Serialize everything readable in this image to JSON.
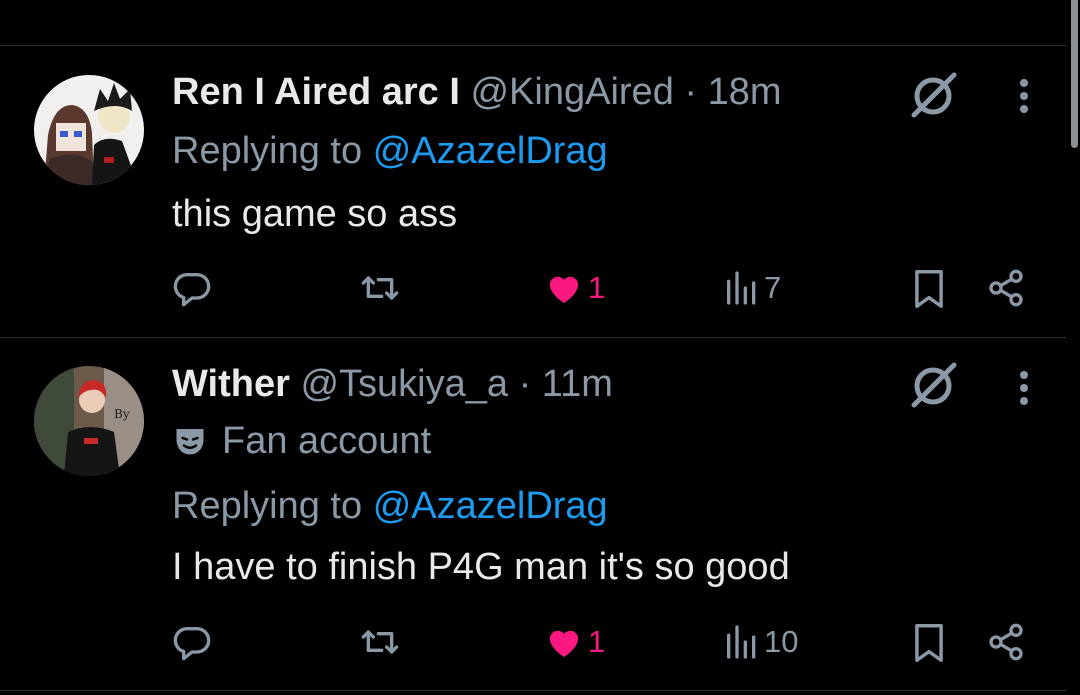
{
  "tweets": [
    {
      "name": "Ren I Aired arc I",
      "handle": "@KingAired",
      "separator": "·",
      "time": "18m",
      "replying_prefix": "Replying to",
      "replying_to": "@AzazelDrag",
      "text": "this game so ass",
      "likes": "1",
      "views": "7",
      "liked": true
    },
    {
      "name": "Wither",
      "handle": "@Tsukiya_a",
      "separator": "·",
      "time": "11m",
      "badge": "Fan account",
      "replying_prefix": "Replying to",
      "replying_to": "@AzazelDrag",
      "text": "I have to finish P4G man it's so good",
      "likes": "1",
      "views": "10",
      "liked": true
    }
  ],
  "colors": {
    "background": "#000000",
    "text": "#e7e9ea",
    "muted": "#8b98a5",
    "link": "#1d9bf0",
    "like": "#f91880",
    "divider": "#2f3336"
  },
  "icons": [
    "grok-icon",
    "more-icon",
    "reply-icon",
    "retweet-icon",
    "heart-icon",
    "views-icon",
    "bookmark-icon",
    "share-icon",
    "mask-icon"
  ]
}
